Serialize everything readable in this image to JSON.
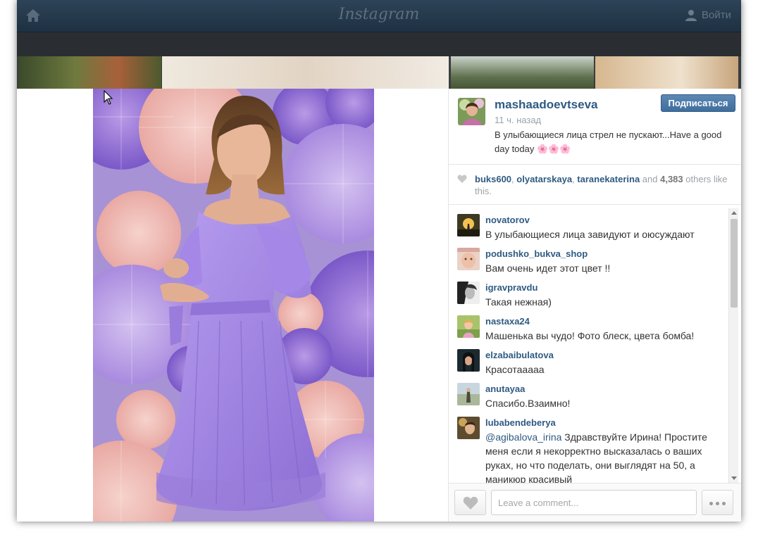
{
  "app": {
    "brand": "Instagram",
    "login_label": "Войти"
  },
  "post": {
    "owner": "mashaadoevtseva",
    "time": "11 ч. назад",
    "caption": "В улыбающиеся лица стрел не пускают...Have a good day today 🌸🌸🌸",
    "follow_label": "Подписаться"
  },
  "likes": {
    "users": [
      "buks600",
      "olyatarskaya",
      "taranekaterina"
    ],
    "sep1": ", ",
    "sep2": ", ",
    "and_label": " and ",
    "count": "4,383",
    "suffix": " others like this."
  },
  "comments": [
    {
      "user": "novatorov",
      "text": "В улыбающиеся лица завидуют и оюсуждают"
    },
    {
      "user": "podushko_bukva_shop",
      "text": "Вам очень идет этот цвет !!"
    },
    {
      "user": "igravpravdu",
      "text": "Такая нежная)"
    },
    {
      "user": "nastaxa24",
      "text": "Машенька вы чудо! Фото блеск, цвета бомба!"
    },
    {
      "user": "elzabaibulatova",
      "text": "Красотааааа"
    },
    {
      "user": "anutayaa",
      "text": "Спасибо.Взаимно!"
    },
    {
      "user": "lubabendeberya",
      "mention": "@agibalova_irina",
      "text": " Здравствуйте Ирина! Простите меня если я некорректно высказалась о ваших руках, но что поделать, они выглядят на 50, а маникюр красивый"
    }
  ],
  "composer": {
    "placeholder": "Leave a comment..."
  },
  "colors": {
    "link": "#2f5a82",
    "follow_button": "#4a78a6",
    "dress": "#a98ee0"
  },
  "icons": {
    "home": "home-icon",
    "user": "user-icon",
    "heart": "heart-icon",
    "more": "more-icon",
    "cursor": "cursor-icon"
  }
}
